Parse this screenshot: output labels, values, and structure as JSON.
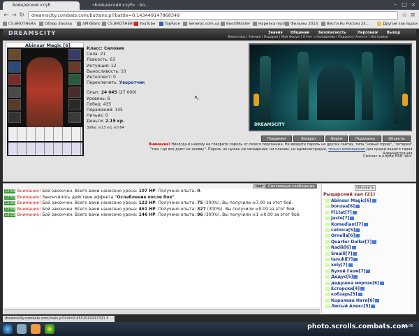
{
  "browser": {
    "tabs": [
      {
        "label": "Бойцовский клуб"
      },
      {
        "label": "«Бойцовский клуб» - Бо..."
      }
    ],
    "url": "dreamscity.combats.com/buttons.pl?battle=0.143449147868349",
    "bookmarks": [
      "CS.BROTHERS",
      "Обзор Заказа",
      "AMXBans",
      "CS.BROTHERS",
      "YouTube",
      "TopFace",
      "Seneroc.com.ua",
      "BoostMaster",
      "Нарезка mp3",
      "Фильмы 2014",
      "Вести.Ru Россия 24...",
      "Другие закладки"
    ]
  },
  "game": {
    "logo": "DREAMSCITY",
    "menu": [
      "Знания",
      "Общение",
      "Безопасность",
      "Персонаж",
      "Выход"
    ],
    "submenu": "Инвентарь | Умения | Подарки | Мой Форум | Отчет о Нападении | Подарки | Анкета | Настройки"
  },
  "character": {
    "name": "Abinsur Magic",
    "level": "[6]",
    "class_line": "Класс: Силовик",
    "stats": [
      "Сила: 21",
      "Ловкость: 63",
      "Интуиция: 12",
      "Выносливость: 10",
      "Интеллект: 0"
    ],
    "switch_label": "Переключить: ",
    "switch_value": "Уворотчик",
    "exp_label": "Опыт: ",
    "exp_value": "24 045",
    "exp_next": " (27 000)",
    "details": [
      "Уровень: 6",
      "Побед: 433",
      "Поражений: 145",
      "Ничьих: 0"
    ],
    "money_label": "Деньги: ",
    "money_value": "2.19 кр.",
    "teeth": "Зубы: ☠13 ☠1 ☠0.64"
  },
  "scene": {
    "logo": "DREAMSCITY"
  },
  "buttons": [
    "Поединки",
    "Возврат",
    "Форум",
    "Подсказка",
    "Объекты"
  ],
  "warning": {
    "label": "Внимание!",
    "text": " Никогда и никому не говорите пароль от своего персонажа. Не вводите пароль на других сайтах, типа \"новый город\", \"лотерея\", \"там, где все дают на халяву\". Пароль не нужен ни паладинам, ни кланам, ни администрации, ",
    "link": "только взломщикам",
    "tail": " для кражи вашего героя. Администрация."
  },
  "online": "Сейчас в клубе 656 чел.",
  "chat": {
    "tabs": [
      "Чат",
      "Системные сообщения"
    ],
    "lines": [
      {
        "time": "12:53",
        "alert": "Внимание!",
        "pre": " Бой закончен. Всего вами нанесено урона: ",
        "b1": "107 HP",
        "mid": ". Получено опыта: ",
        "b2": "0",
        "post": "."
      },
      {
        "time": "12:53",
        "alert": "Внимание!",
        "pre": " Закончилось действие эффекта ",
        "b1": "\"Ослабление после боя\"",
        "mid": "",
        "b2": "",
        "post": ""
      },
      {
        "time": "12:55",
        "alert": "Внимание!",
        "pre": " Бой закончен. Всего вами нанесено урона: ",
        "b1": "122 HP",
        "mid": ". Получено опыта: ",
        "b2": "75",
        "post": " (300%). Вы получили ☠7.00 за этот бой."
      },
      {
        "time": "12:59",
        "alert": "Внимание!",
        "pre": " Бой закончен. Всего вами нанесено урона: ",
        "b1": "461 HP",
        "mid": ". Получено опыта: ",
        "b2": "327",
        "post": " (300%). Вы получили ☠9.00 за этот бой."
      },
      {
        "time": "13:03",
        "alert": "Внимание!",
        "pre": " Бой закончен. Всего вами нанесено урона: ",
        "b1": "146 HP",
        "mid": ". Получено опыта: ",
        "b2": "96",
        "post": " (300%). Вы получили ☠1 ☠0.00 за этот бой."
      }
    ]
  },
  "room": {
    "refresh": "Обновить",
    "title": "Рыцарский зал (21)",
    "players": [
      "Abinsur Magic[6]",
      "bonzaa[6]",
      "Fl1tat[7]",
      "Jaste[7]",
      "Komediant[7]",
      "Letnica[5]",
      "Ornella[6]",
      "Quarter Dollar[7]",
      "Radik[6]",
      "Smaill[7]",
      "tanuki[7]",
      "xely[7]",
      "Бухой Гном[7]",
      "Дедус[5]",
      "дедушка морозк[6]",
      "Есторски[4]",
      "кобзарь[5]",
      "Королева Нати[6]",
      "Лютый Алекс[5]"
    ]
  },
  "status_url": "dreamscity.combats.com/main.pl?intl=0.4552019147321 5",
  "watermark": "photo.scrolls.combats.com",
  "clock": "13:05"
}
